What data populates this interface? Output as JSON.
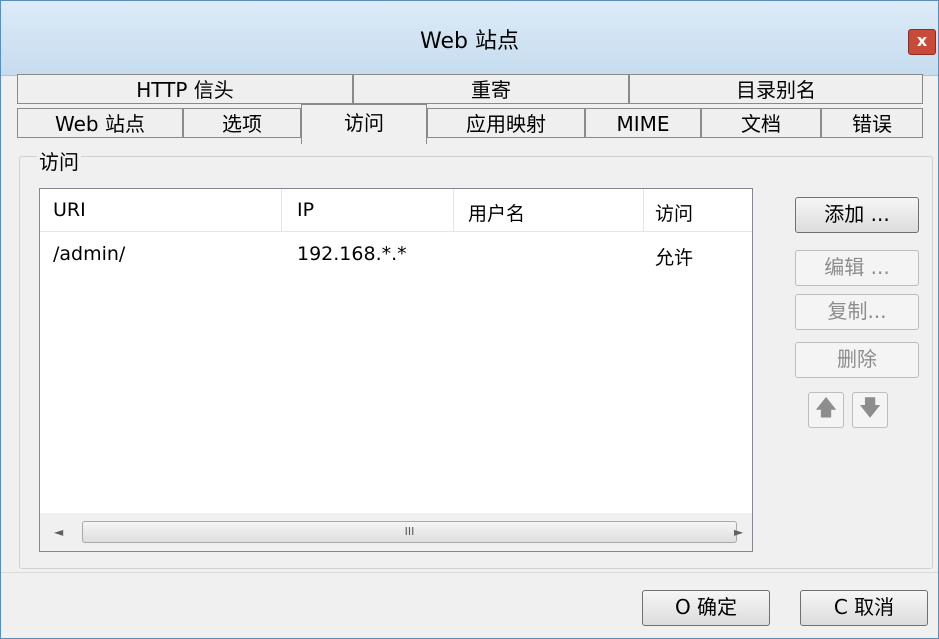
{
  "window": {
    "title": "Web 站点",
    "close_glyph": "x"
  },
  "tabs": {
    "row1": [
      {
        "label": "HTTP 信头"
      },
      {
        "label": "重寄"
      },
      {
        "label": "目录别名"
      }
    ],
    "row2": [
      {
        "label": "Web 站点"
      },
      {
        "label": "选项"
      },
      {
        "label": "访问",
        "active": true
      },
      {
        "label": "应用映射"
      },
      {
        "label": "MIME"
      },
      {
        "label": "文档"
      },
      {
        "label": "错误"
      }
    ]
  },
  "group": {
    "title": "访问"
  },
  "table": {
    "columns": [
      "URI",
      "IP",
      "用户名",
      "访问"
    ],
    "rows": [
      [
        "/admin/",
        "192.168.*.*",
        "",
        "允许"
      ]
    ]
  },
  "scrollbar": {
    "left": "◄",
    "right": "►",
    "thumb": "III"
  },
  "buttons": {
    "add": "添加 ...",
    "edit": "编辑 ...",
    "copy": "复制...",
    "delete": "删除",
    "move_up": "🡅",
    "move_down": "🡇",
    "ok": "O 确定",
    "cancel": "C 取消"
  },
  "icons": {
    "up": "arrow-up-icon",
    "down": "arrow-down-icon",
    "close": "close-icon"
  },
  "colors": {
    "titlebar": "#c6dcef",
    "close_button": "#c74a3a",
    "dialog_bg": "#f0f0f0"
  }
}
